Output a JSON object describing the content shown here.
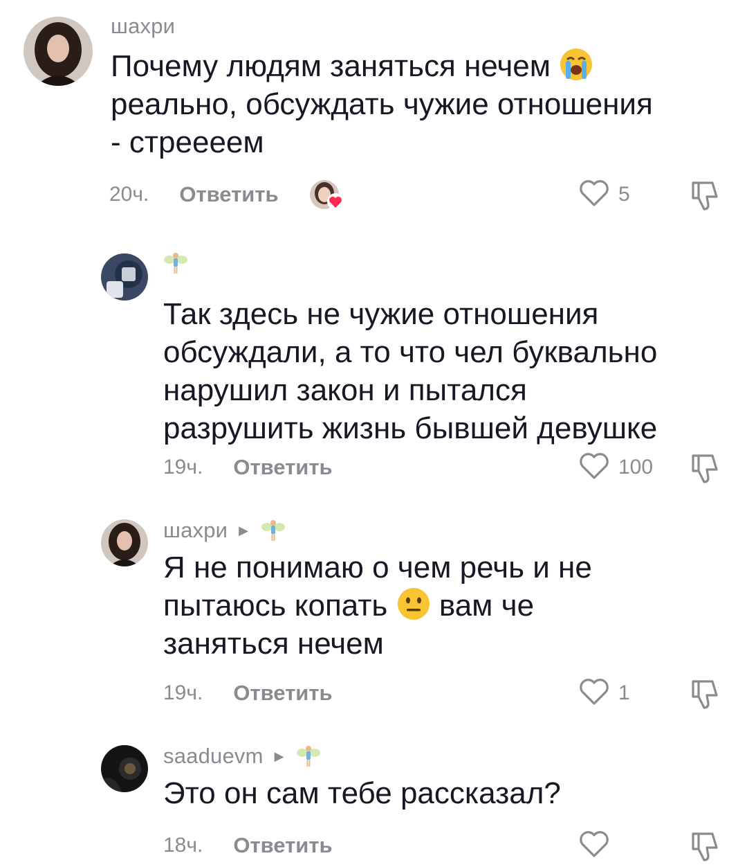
{
  "comments": [
    {
      "username": "шахри",
      "text_lines": [
        "Почему людям заняться нечем",
        "реально, обсуждать чужие отношения",
        "- стреееем"
      ],
      "emoji": "loudly-crying-face",
      "time": "20ч.",
      "reply_label": "Ответить",
      "likes": "5",
      "liked_by_creator": true
    },
    {
      "username": "",
      "text_lines": [
        "Так здесь не чужие отношения",
        "обсуждали, а то что чел буквально",
        "нарушил закон и пытался",
        "разрушить жизнь бывшей девушке"
      ],
      "time": "19ч.",
      "reply_label": "Ответить",
      "likes": "100"
    },
    {
      "username": "шахри",
      "text_lines": [
        "Я не понимаю о чем речь и не",
        "пытаюсь копать",
        "вам че",
        "заняться нечем"
      ],
      "emoji": "neutral-face",
      "time": "19ч.",
      "reply_label": "Ответить",
      "likes": "1"
    },
    {
      "username": "saaduevm",
      "text_lines": [
        "Это он сам тебе рассказал?"
      ],
      "time": "18ч.",
      "reply_label": "Ответить",
      "likes": ""
    }
  ],
  "icons": {
    "like": "heart-outline-icon",
    "dislike": "thumbs-down-icon",
    "reply_indicator": "triangle-right-icon",
    "fairy": "fairy-emoji-icon"
  },
  "colors": {
    "text": "#161823",
    "secondary": "#8a8b91",
    "heart_badge": "#fe2c55"
  }
}
